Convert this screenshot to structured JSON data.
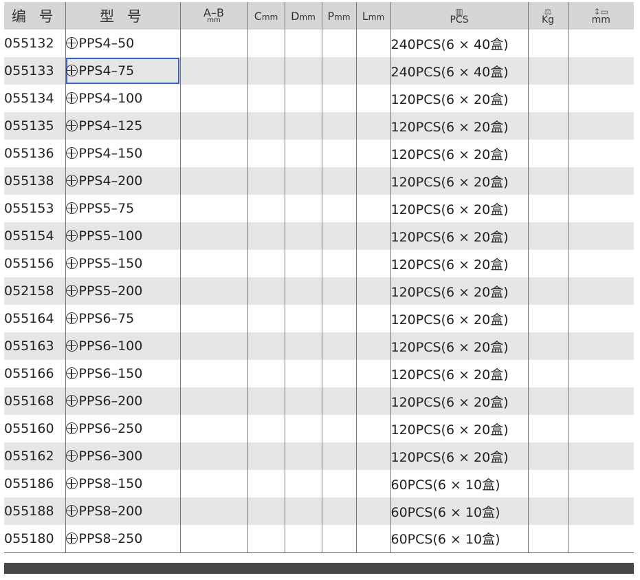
{
  "header": {
    "code": "编 号",
    "model": "型 号",
    "ab": "A–B",
    "ab_unit": "mm",
    "c": "C",
    "d": "D",
    "p": "P",
    "l": "L",
    "dim_unit": "mm",
    "pcs": "PCS",
    "kg": "Kg",
    "mm": "mm",
    "box_icon": "box-icon",
    "weight_icon": "weight-icon",
    "size_icon": "size-icon"
  },
  "rows": [
    {
      "code": "055132",
      "model": "PPS4–50",
      "pack": "240PCS(6 × 40盒)"
    },
    {
      "code": "055133",
      "model": "PPS4–75",
      "pack": "240PCS(6 × 40盒)"
    },
    {
      "code": "055134",
      "model": "PPS4–100",
      "pack": "120PCS(6 × 20盒)"
    },
    {
      "code": "055135",
      "model": "PPS4–125",
      "pack": "120PCS(6 × 20盒)"
    },
    {
      "code": "055136",
      "model": "PPS4–150",
      "pack": "120PCS(6 × 20盒)"
    },
    {
      "code": "055138",
      "model": "PPS4–200",
      "pack": "120PCS(6 × 20盒)"
    },
    {
      "code": "055153",
      "model": "PPS5–75",
      "pack": "120PCS(6 × 20盒)"
    },
    {
      "code": "055154",
      "model": "PPS5–100",
      "pack": "120PCS(6 × 20盒)"
    },
    {
      "code": "055156",
      "model": "PPS5–150",
      "pack": "120PCS(6 × 20盒)"
    },
    {
      "code": "052158",
      "model": "PPS5–200",
      "pack": "120PCS(6 × 20盒)"
    },
    {
      "code": "055164",
      "model": "PPS6–75",
      "pack": "120PCS(6 × 20盒)"
    },
    {
      "code": "055163",
      "model": "PPS6–100",
      "pack": "120PCS(6 × 20盒)"
    },
    {
      "code": "055166",
      "model": "PPS6–150",
      "pack": "120PCS(6 × 20盒)"
    },
    {
      "code": "055168",
      "model": "PPS6–200",
      "pack": "120PCS(6 × 20盒)"
    },
    {
      "code": "055160",
      "model": "PPS6–250",
      "pack": "120PCS(6 × 20盒)"
    },
    {
      "code": "055162",
      "model": "PPS6–300",
      "pack": "120PCS(6 × 20盒)"
    },
    {
      "code": "055186",
      "model": "PPS8–150",
      "pack": "60PCS(6 × 10盒)"
    },
    {
      "code": "055188",
      "model": "PPS8–200",
      "pack": "60PCS(6 × 10盒)"
    },
    {
      "code": "055180",
      "model": "PPS8–250",
      "pack": "60PCS(6 × 10盒)"
    }
  ],
  "selected_row": 1,
  "colors": {
    "header_bg": "#d6d6d6",
    "stripe_bg": "#e6e6e6",
    "selection": "#3a64c8",
    "footer_bar": "#474747"
  }
}
